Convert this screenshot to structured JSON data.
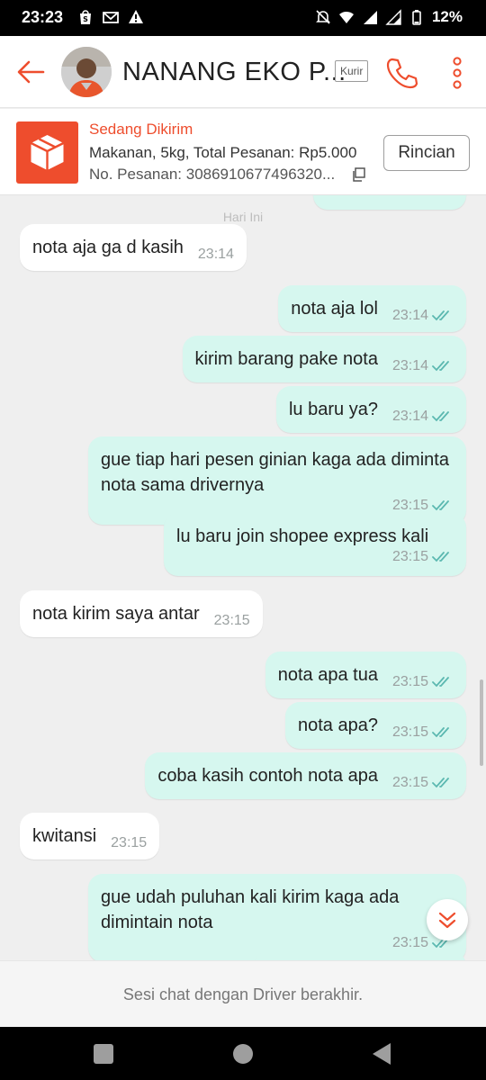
{
  "status_bar": {
    "time": "23:23",
    "battery": "12%"
  },
  "header": {
    "contact_name": "NANANG EKO P...",
    "role_badge": "Kurir"
  },
  "order": {
    "status": "Sedang Dikirim",
    "description": "Makanan, 5kg, Total Pesanan: Rp5.000",
    "order_number": "No. Pesanan: 3086910677496320...",
    "details_button": "Rincian"
  },
  "chat": {
    "date_separator": "Hari Ini",
    "messages": [
      {
        "dir": "in",
        "text": "nota aja ga d kasih",
        "time": "23:14"
      },
      {
        "dir": "out",
        "text": "nota aja lol",
        "time": "23:14",
        "read": true
      },
      {
        "dir": "out",
        "text": "kirim barang pake nota",
        "time": "23:14",
        "read": true
      },
      {
        "dir": "out",
        "text": "lu baru ya?",
        "time": "23:14",
        "read": true
      },
      {
        "dir": "out",
        "text": "gue tiap hari pesen ginian kaga ada diminta nota sama drivernya",
        "time": "23:15",
        "read": true
      },
      {
        "dir": "out",
        "text": "lu baru join shopee express kali",
        "time": "23:15",
        "read": true
      },
      {
        "dir": "in",
        "text": "nota kirim saya antar",
        "time": "23:15"
      },
      {
        "dir": "out",
        "text": "nota apa tua",
        "time": "23:15",
        "read": true
      },
      {
        "dir": "out",
        "text": "nota apa?",
        "time": "23:15",
        "read": true
      },
      {
        "dir": "out",
        "text": "coba kasih contoh nota apa",
        "time": "23:15",
        "read": true
      },
      {
        "dir": "in",
        "text": "kwitansi",
        "time": "23:15"
      },
      {
        "dir": "out",
        "text": "gue udah puluhan kali kirim kaga ada dimintain nota",
        "time": "23:15",
        "read": true
      }
    ]
  },
  "footer": {
    "notice": "Sesi chat dengan Driver berakhir."
  },
  "colors": {
    "brand": "#ee4d2d",
    "outgoing_bubble": "#d6f7ef",
    "incoming_bubble": "#ffffff",
    "tick": "#5bb8b0"
  }
}
